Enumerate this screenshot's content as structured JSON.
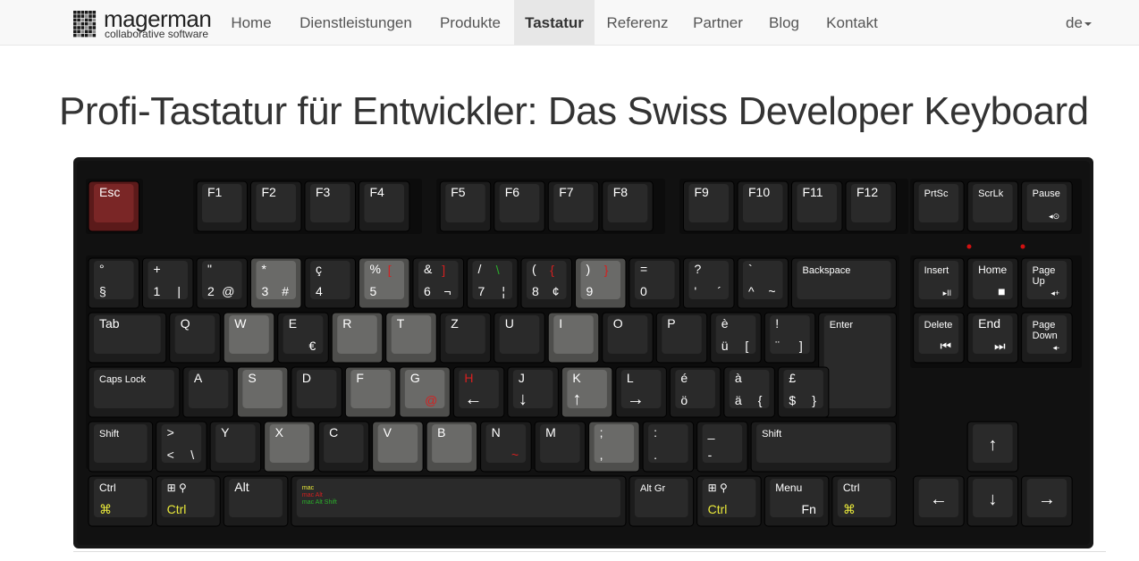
{
  "brand": {
    "name": "magerman",
    "tagline": "collaborative software"
  },
  "nav": {
    "items": [
      {
        "label": "Home"
      },
      {
        "label": "Dienstleistungen"
      },
      {
        "label": "Produkte"
      },
      {
        "label": "Tastatur",
        "active": true
      },
      {
        "label": "Referenz"
      },
      {
        "label": "Partner"
      },
      {
        "label": "Blog"
      },
      {
        "label": "Kontakt"
      }
    ],
    "language": "de"
  },
  "page": {
    "title": "Profi-Tastatur für Entwickler: Das Swiss Developer Keyboard"
  },
  "colors": {
    "case": "#111111",
    "key": "#1c1c1c",
    "key_top": "#2a2a2a",
    "key_gray": "#4e4e4c",
    "key_gray_top": "#6a6a68",
    "esc": "#5b1a1a",
    "esc_top": "#7a2626",
    "legend": "#ffffff",
    "yellow": "#e8e83a",
    "red": "#d42020",
    "green": "#2ab02a",
    "led": "#d11111"
  },
  "keyboard": {
    "rows": [
      [
        {
          "l": "Esc",
          "x": 0,
          "w": 1,
          "c": "esc"
        },
        {
          "l": "F1",
          "x": 2,
          "w": 1
        },
        {
          "l": "F2",
          "x": 3,
          "w": 1
        },
        {
          "l": "F3",
          "x": 4,
          "w": 1
        },
        {
          "l": "F4",
          "x": 5,
          "w": 1
        },
        {
          "l": "F5",
          "x": 6.5,
          "w": 1
        },
        {
          "l": "F6",
          "x": 7.5,
          "w": 1
        },
        {
          "l": "F7",
          "x": 8.5,
          "w": 1
        },
        {
          "l": "F8",
          "x": 9.5,
          "w": 1
        },
        {
          "l": "F9",
          "x": 11,
          "w": 1
        },
        {
          "l": "F10",
          "x": 12,
          "w": 1
        },
        {
          "l": "F11",
          "x": 13,
          "w": 1
        },
        {
          "l": "F12",
          "x": 14,
          "w": 1
        },
        {
          "l": "PrtSc",
          "x": 15.25,
          "w": 1
        },
        {
          "l": "ScrLk",
          "x": 16.25,
          "w": 1
        },
        {
          "l": "Pause",
          "x": 17.25,
          "w": 1,
          "br": "◂⊙"
        }
      ],
      [
        {
          "l": "°",
          "bl": "§",
          "x": 0,
          "w": 1
        },
        {
          "l": "+",
          "bl": "1",
          "br": "|",
          "x": 1,
          "w": 1
        },
        {
          "l": "\"",
          "bl": "2",
          "br": "@",
          "x": 2,
          "w": 1
        },
        {
          "l": "*",
          "bl": "3",
          "br": "#",
          "x": 3,
          "w": 1,
          "c": "gray"
        },
        {
          "l": "ç",
          "bl": "4",
          "x": 4,
          "w": 1
        },
        {
          "l": "%",
          "tr": "[",
          "trc": "red",
          "bl": "5",
          "x": 5,
          "w": 1,
          "c": "gray"
        },
        {
          "l": "&",
          "tr": "]",
          "trc": "red",
          "bl": "6",
          "br": "¬",
          "x": 6,
          "w": 1
        },
        {
          "l": "/",
          "tr": "\\",
          "trc": "green",
          "bl": "7",
          "br": "¦",
          "x": 7,
          "w": 1
        },
        {
          "l": "(",
          "tr": "{",
          "trc": "red",
          "bl": "8",
          "br": "¢",
          "x": 8,
          "w": 1
        },
        {
          "l": ")",
          "tr": "}",
          "trc": "red",
          "bl": "9",
          "x": 9,
          "w": 1,
          "c": "gray"
        },
        {
          "l": "=",
          "bl": "0",
          "x": 10,
          "w": 1
        },
        {
          "l": "?",
          "bl": "'",
          "br": "´",
          "x": 11,
          "w": 1
        },
        {
          "l": "`",
          "bl": "^",
          "br": "~",
          "x": 12,
          "w": 1
        },
        {
          "l": "Backspace",
          "x": 13,
          "w": 2
        },
        {
          "l": "Insert",
          "br": "▸II",
          "x": 15.25,
          "w": 1
        },
        {
          "l": "Home",
          "br": "■",
          "x": 16.25,
          "w": 1
        },
        {
          "l": "Page Up",
          "br": "◂+",
          "x": 17.25,
          "w": 1
        }
      ],
      [
        {
          "l": "Tab",
          "x": 0,
          "w": 1.5
        },
        {
          "l": "Q",
          "x": 1.5,
          "w": 1
        },
        {
          "l": "W",
          "x": 2.5,
          "w": 1,
          "c": "gray"
        },
        {
          "l": "E",
          "br": "€",
          "x": 3.5,
          "w": 1
        },
        {
          "l": "R",
          "x": 4.5,
          "w": 1,
          "c": "gray"
        },
        {
          "l": "T",
          "x": 5.5,
          "w": 1,
          "c": "gray"
        },
        {
          "l": "Z",
          "x": 6.5,
          "w": 1
        },
        {
          "l": "U",
          "x": 7.5,
          "w": 1
        },
        {
          "l": "I",
          "x": 8.5,
          "w": 1,
          "c": "gray"
        },
        {
          "l": "O",
          "x": 9.5,
          "w": 1
        },
        {
          "l": "P",
          "x": 10.5,
          "w": 1
        },
        {
          "l": "è",
          "bl": "ü",
          "br": "[",
          "x": 11.5,
          "w": 1
        },
        {
          "l": "!",
          "bl": "¨",
          "br": "]",
          "x": 12.5,
          "w": 1
        },
        {
          "l": "Enter",
          "x": 13.5,
          "w": 1.5,
          "enter": true
        },
        {
          "l": "Delete",
          "br": "⏮",
          "x": 15.25,
          "w": 1
        },
        {
          "l": "End",
          "br": "⏭",
          "x": 16.25,
          "w": 1
        },
        {
          "l": "Page Down",
          "br": "◂-",
          "x": 17.25,
          "w": 1
        }
      ],
      [
        {
          "l": "Caps Lock",
          "x": 0,
          "w": 1.75
        },
        {
          "l": "A",
          "x": 1.75,
          "w": 1
        },
        {
          "l": "S",
          "x": 2.75,
          "w": 1,
          "c": "gray"
        },
        {
          "l": "D",
          "x": 3.75,
          "w": 1
        },
        {
          "l": "F",
          "x": 4.75,
          "w": 1,
          "c": "gray"
        },
        {
          "l": "G",
          "br": "@",
          "brc": "red",
          "x": 5.75,
          "w": 1,
          "c": "gray"
        },
        {
          "l": "H",
          "lc": "red",
          "bl": "←",
          "x": 6.75,
          "w": 1
        },
        {
          "l": "J",
          "bl": "↓",
          "x": 7.75,
          "w": 1
        },
        {
          "l": "K",
          "bl": "↑",
          "x": 8.75,
          "w": 1,
          "c": "gray"
        },
        {
          "l": "L",
          "bl": "→",
          "x": 9.75,
          "w": 1
        },
        {
          "l": "é",
          "bl": "ö",
          "x": 10.75,
          "w": 1
        },
        {
          "l": "à",
          "bl": "ä",
          "br": "{",
          "x": 11.75,
          "w": 1
        },
        {
          "l": "£",
          "bl": "$",
          "br": "}",
          "x": 12.75,
          "w": 1
        }
      ],
      [
        {
          "l": "Shift",
          "x": 0,
          "w": 1.25
        },
        {
          "l": ">",
          "bl": "<",
          "br": "\\",
          "x": 1.25,
          "w": 1
        },
        {
          "l": "Y",
          "x": 2.25,
          "w": 1
        },
        {
          "l": "X",
          "x": 3.25,
          "w": 1,
          "c": "gray"
        },
        {
          "l": "C",
          "x": 4.25,
          "w": 1
        },
        {
          "l": "V",
          "x": 5.25,
          "w": 1,
          "c": "gray"
        },
        {
          "l": "B",
          "x": 6.25,
          "w": 1,
          "c": "gray"
        },
        {
          "l": "N",
          "br": "~",
          "brc": "red",
          "x": 7.25,
          "w": 1
        },
        {
          "l": "M",
          "x": 8.25,
          "w": 1
        },
        {
          "l": ";",
          "bl": ",",
          "x": 9.25,
          "w": 1,
          "c": "gray"
        },
        {
          "l": ":",
          "bl": ".",
          "x": 10.25,
          "w": 1
        },
        {
          "l": "_",
          "bl": "-",
          "x": 11.25,
          "w": 1
        },
        {
          "l": "Shift",
          "x": 12.25,
          "w": 2.75
        },
        {
          "l": "↑",
          "x": 16.25,
          "w": 1,
          "big": true
        }
      ],
      [
        {
          "l": "Ctrl",
          "bl": "⌘",
          "blc": "yellow",
          "x": 0,
          "w": 1.25
        },
        {
          "l": "⊞  ⚲",
          "bl": "Ctrl",
          "blc": "yellow",
          "x": 1.25,
          "w": 1.25,
          "win": true
        },
        {
          "l": "Alt",
          "x": 2.5,
          "w": 1.25
        },
        {
          "l": "",
          "x": 3.75,
          "w": 6.25,
          "space": true
        },
        {
          "l": "Alt Gr",
          "x": 10,
          "w": 1.25
        },
        {
          "l": "⊞  ⚲",
          "bl": "Ctrl",
          "blc": "yellow",
          "x": 11.25,
          "w": 1.25,
          "win": true
        },
        {
          "l": "Menu",
          "br": "Fn",
          "x": 12.5,
          "w": 1.25
        },
        {
          "l": "Ctrl",
          "bl": "⌘",
          "blc": "yellow",
          "x": 13.75,
          "w": 1.25
        },
        {
          "l": "←",
          "x": 15.25,
          "w": 1,
          "big": true
        },
        {
          "l": "↓",
          "x": 16.25,
          "w": 1,
          "big": true
        },
        {
          "l": "→",
          "x": 17.25,
          "w": 1,
          "big": true
        }
      ]
    ],
    "space_legends": [
      {
        "text": "mac",
        "color": "yellow"
      },
      {
        "text": "mac Alt",
        "color": "red"
      },
      {
        "text": "mac Alt Shift",
        "color": "green"
      }
    ],
    "leds": 2
  }
}
